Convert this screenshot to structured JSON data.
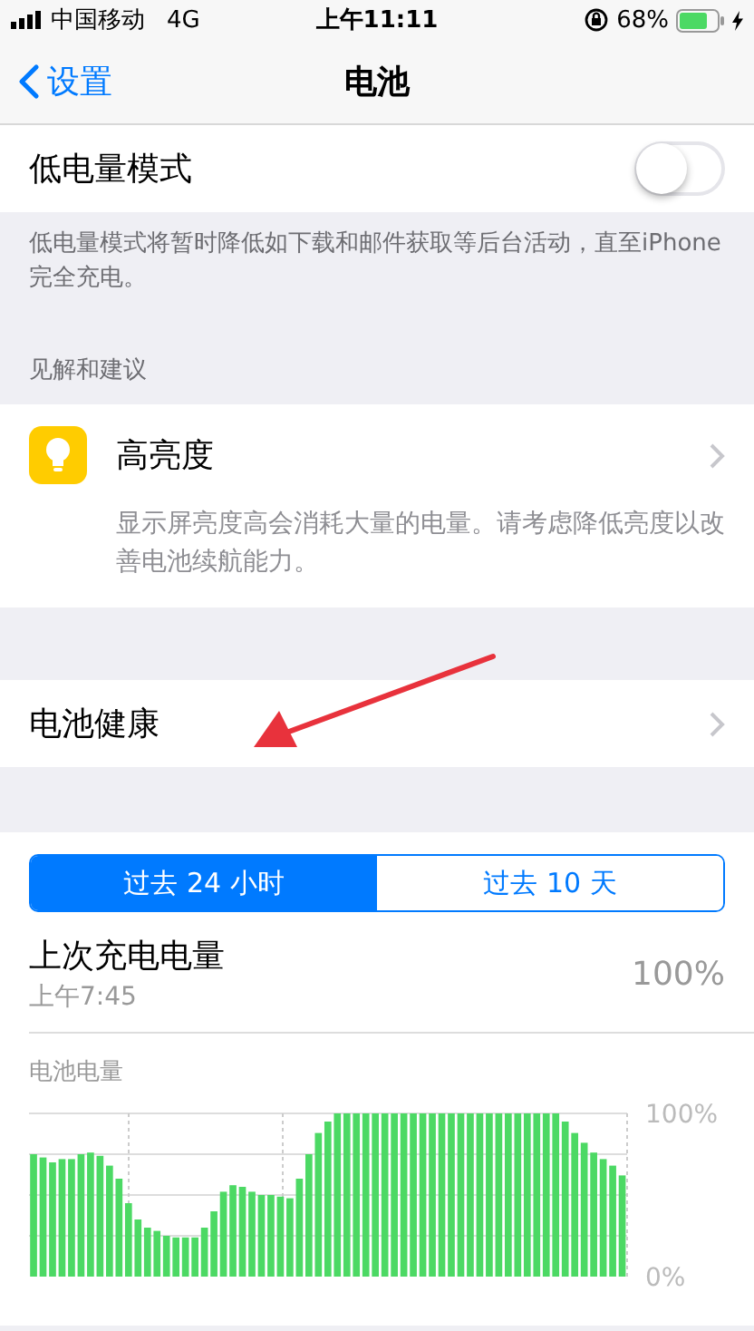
{
  "status_bar": {
    "carrier": "中国移动",
    "network": "4G",
    "time": "上午11:11",
    "battery": "68%",
    "charging": true
  },
  "nav": {
    "back": "设置",
    "title": "电池"
  },
  "low_power": {
    "label": "低电量模式",
    "on": false,
    "footer": "低电量模式将暂时降低如下载和邮件获取等后台活动，直至iPhone 完全充电。"
  },
  "insights": {
    "header": "见解和建议",
    "items": [
      {
        "title": "高亮度",
        "description": "显示屏亮度高会消耗大量的电量。请考虑降低亮度以改善电池续航能力。"
      }
    ]
  },
  "battery_health": {
    "label": "电池健康"
  },
  "usage": {
    "tabs": [
      {
        "label": "过去 24 小时",
        "selected": true
      },
      {
        "label": "过去 10 天",
        "selected": false
      }
    ],
    "last_charge": {
      "label": "上次充电电量",
      "time": "上午7:45",
      "value": "100%"
    },
    "chart": {
      "title": "电池电量",
      "chart_data": {
        "type": "bar",
        "ylim": [
          0,
          100
        ],
        "yticks": [
          {
            "value": 100,
            "label": "100%"
          },
          {
            "value": 0,
            "label": "0%"
          }
        ],
        "values": [
          75,
          73,
          70,
          72,
          72,
          75,
          76,
          74,
          68,
          60,
          45,
          35,
          30,
          28,
          25,
          24,
          24,
          24,
          30,
          40,
          52,
          56,
          55,
          52,
          50,
          50,
          49,
          48,
          60,
          75,
          88,
          95,
          100,
          100,
          100,
          100,
          100,
          100,
          100,
          100,
          100,
          100,
          100,
          100,
          100,
          100,
          100,
          100,
          100,
          100,
          100,
          100,
          100,
          100,
          100,
          100,
          95,
          88,
          82,
          76,
          72,
          68,
          62
        ]
      }
    }
  }
}
